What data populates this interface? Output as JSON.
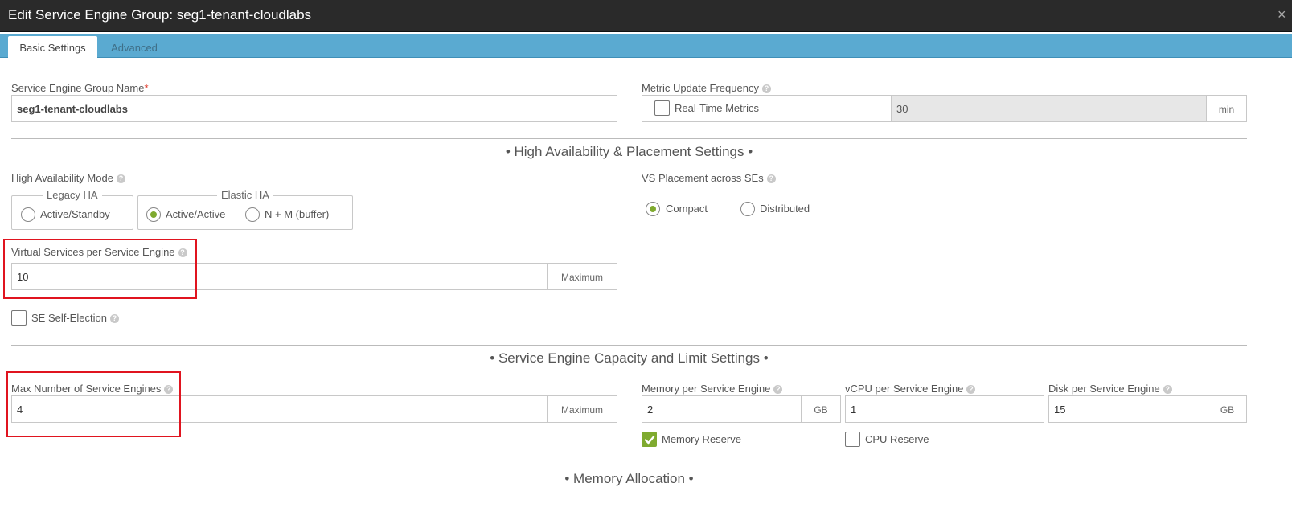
{
  "window": {
    "title": "Edit Service Engine Group: seg1-tenant-cloudlabs",
    "close_glyph": "×"
  },
  "tabs": [
    {
      "label": "Basic Settings",
      "active": true
    },
    {
      "label": "Advanced",
      "active": false
    }
  ],
  "group_name": {
    "label": "Service Engine Group Name",
    "required_mark": "*",
    "value": "seg1-tenant-cloudlabs"
  },
  "metric": {
    "label": "Metric Update Frequency",
    "checkbox_label": "Real-Time Metrics",
    "checked": false,
    "value": "30",
    "unit": "min"
  },
  "sections": {
    "ha": "• High Availability & Placement Settings •",
    "capacity": "•  Service Engine Capacity and Limit Settings  •",
    "memory": "• Memory Allocation •"
  },
  "ha_mode": {
    "label": "High Availability Mode",
    "legacy_legend": "Legacy HA",
    "elastic_legend": "Elastic HA",
    "options": [
      {
        "label": "Active/Standby",
        "selected": false
      },
      {
        "label": "Active/Active",
        "selected": true
      },
      {
        "label": "N + M (buffer)",
        "selected": false
      }
    ]
  },
  "placement": {
    "label": "VS Placement across SEs",
    "options": [
      {
        "label": "Compact",
        "selected": true
      },
      {
        "label": "Distributed",
        "selected": false
      }
    ]
  },
  "vs_per_se": {
    "label": "Virtual Services per Service Engine",
    "value": "10",
    "addon": "Maximum"
  },
  "self_election": {
    "label": "SE Self-Election",
    "checked": false
  },
  "max_se": {
    "label": "Max Number of Service Engines",
    "value": "4",
    "addon": "Maximum"
  },
  "memory_per_se": {
    "label": "Memory per Service Engine",
    "value": "2",
    "unit": "GB"
  },
  "vcpu_per_se": {
    "label": "vCPU per Service Engine",
    "value": "1"
  },
  "disk_per_se": {
    "label": "Disk per Service Engine",
    "value": "15",
    "unit": "GB"
  },
  "memory_reserve": {
    "label": "Memory Reserve",
    "checked": true
  },
  "cpu_reserve": {
    "label": "CPU Reserve",
    "checked": false
  },
  "help_glyph": "?",
  "colors": {
    "accent": "#7faa2f",
    "tabbar": "#5aaad1",
    "highlight": "#e0141f",
    "titlebar": "#2a2a2a"
  }
}
